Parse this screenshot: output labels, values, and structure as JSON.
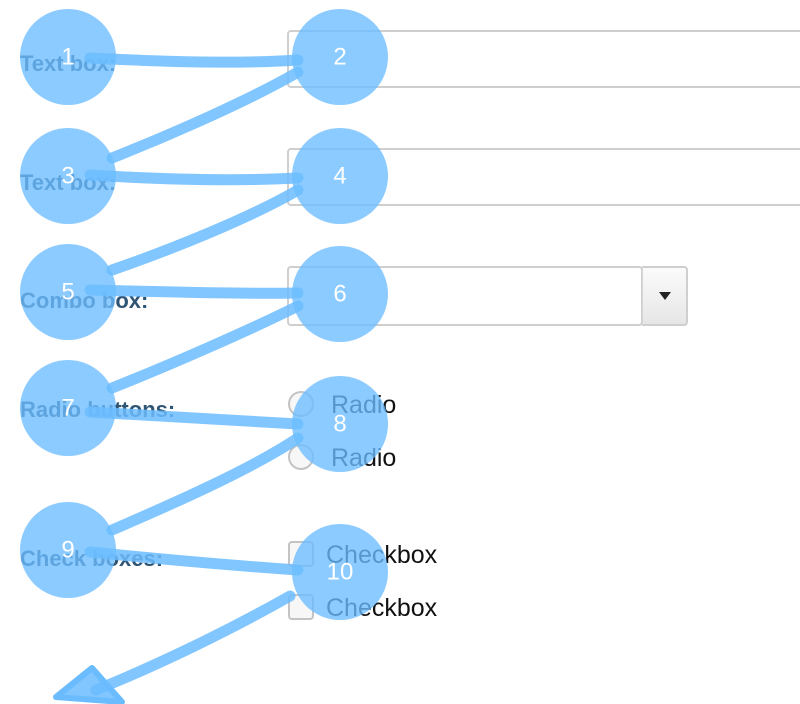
{
  "form": {
    "text_box_1_label": "Text box:",
    "text_box_1_value": "",
    "text_box_2_label": "Text box:",
    "text_box_2_value": "",
    "combo_box_label": "Combo box:",
    "combo_box_value": "",
    "radio_buttons_label": "Radio buttons:",
    "radio_options": [
      "Radio",
      "Radio"
    ],
    "check_boxes_label": "Check boxes:",
    "checkbox_options": [
      "Checkbox",
      "Checkbox"
    ]
  },
  "tab_order": {
    "steps": [
      "1",
      "2",
      "3",
      "4",
      "5",
      "6",
      "7",
      "8",
      "9",
      "10"
    ],
    "color": "#6bbcff",
    "end_marker_icon": "arrow-head-icon"
  }
}
